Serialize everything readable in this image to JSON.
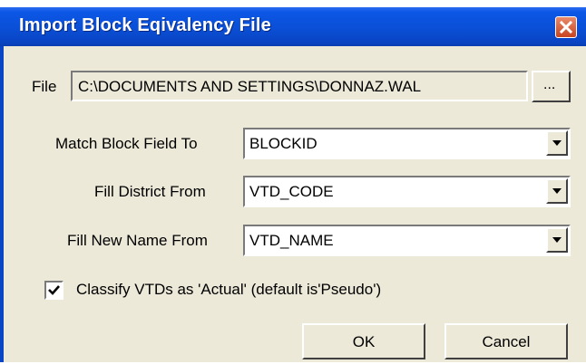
{
  "window": {
    "title": "Import Block Eqivalency File",
    "close_icon": "close-icon"
  },
  "file": {
    "label": "File",
    "path": "C:\\DOCUMENTS AND SETTINGS\\DONNAZ.WAL",
    "browse_label": "..."
  },
  "match_block": {
    "label": "Match Block Field To",
    "value": "BLOCKID"
  },
  "fill_district": {
    "label": "Fill District From",
    "value": "VTD_CODE"
  },
  "fill_new_name": {
    "label": "Fill New Name From",
    "value": "VTD_NAME"
  },
  "classify": {
    "label": "Classify VTDs as 'Actual' (default is'Pseudo')",
    "checked": true
  },
  "buttons": {
    "ok_label": "OK",
    "cancel_label": "Cancel"
  },
  "colors": {
    "titlebar": "#0a4fd6",
    "dialog_bg": "#ece9d8",
    "close_button": "#c9431f"
  }
}
